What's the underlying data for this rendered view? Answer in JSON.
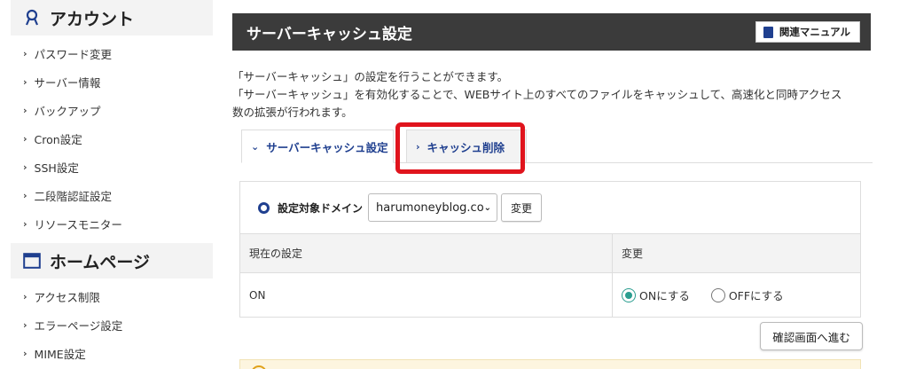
{
  "sidebar": {
    "account": {
      "title": "アカウント",
      "icon": "person-icon",
      "items": [
        {
          "label": "パスワード変更"
        },
        {
          "label": "サーバー情報"
        },
        {
          "label": "バックアップ"
        },
        {
          "label": "Cron設定"
        },
        {
          "label": "SSH設定"
        },
        {
          "label": "二段階認証設定"
        },
        {
          "label": "リソースモニター"
        }
      ]
    },
    "homepage": {
      "title": "ホームページ",
      "icon": "window-icon",
      "items": [
        {
          "label": "アクセス制限"
        },
        {
          "label": "エラーページ設定"
        },
        {
          "label": "MIME設定"
        }
      ]
    }
  },
  "main": {
    "title": "サーバーキャッシュ設定",
    "manual_label": "関連マニュアル",
    "desc_line1": "「サーバーキャッシュ」の設定を行うことができます。",
    "desc_line2": "「サーバーキャッシュ」を有効化することで、WEBサイト上のすべてのファイルをキャッシュして、高速化と同時アクセス",
    "desc_line3": "数の拡張が行われます。"
  },
  "tabs": [
    {
      "label": "サーバーキャッシュ設定",
      "active": true
    },
    {
      "label": "キャッシュ削除",
      "active": false
    }
  ],
  "panel": {
    "domain_label": "設定対象ドメイン",
    "domain_value": "harumoneyblog.co",
    "change_button": "変更",
    "table": {
      "col_current": "現在の設定",
      "col_change": "変更",
      "current_value": "ON",
      "options": [
        {
          "label": "ONにする",
          "selected": true
        },
        {
          "label": "OFFにする",
          "selected": false
        }
      ]
    }
  },
  "confirm_button": "確認画面へ進む",
  "colors": {
    "header_bg": "#3b3b3b",
    "accent_blue": "#1f3f8f",
    "highlight_red": "#e0141d",
    "radio_selected": "#2a9d8f"
  }
}
